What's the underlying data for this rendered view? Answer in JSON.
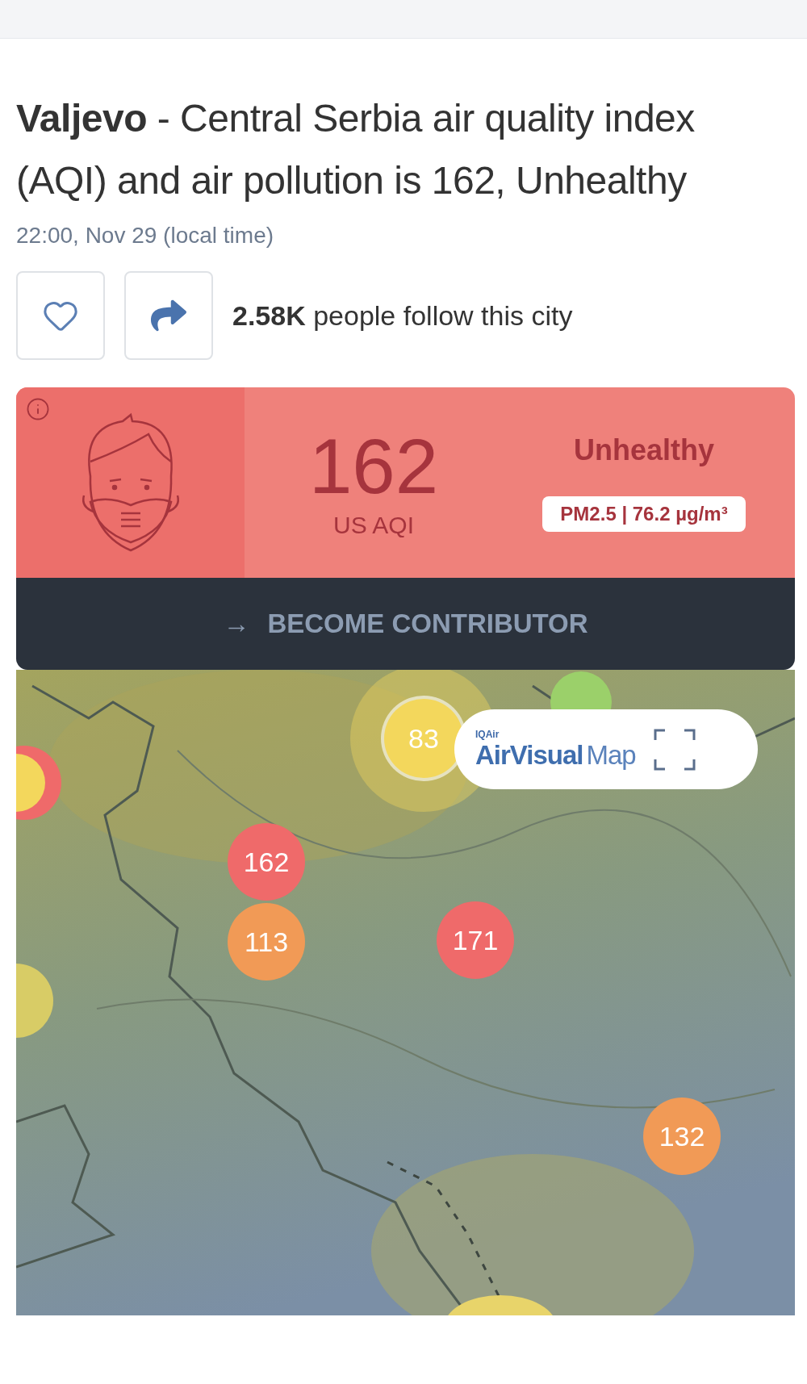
{
  "headline": "**Valjevo** - Central Serbia air quality index (AQI) and air pollution is 162, Unhealthy",
  "timestamp": "22:00, Nov 29 (local time)",
  "follow": {
    "liked": false,
    "text": "**2.58K** people follow this city"
  },
  "aqi": {
    "value": "162",
    "unit": "US AQI",
    "status": "Unhealthy",
    "pollutant": "PM2.5 | 76.2 µg/m³"
  },
  "contributor": {
    "arrow": "→",
    "label": "BECOME CONTRIBUTOR"
  },
  "map": {
    "kind": "picture",
    "badge": {
      "brand": "IQAir",
      "title": "AirVisual",
      "suffix": "Map"
    },
    "markers": [
      {
        "value": "83",
        "color": "#f3d75c",
        "halo": true
      },
      {
        "value": "162",
        "color": "#ef6a6a",
        "halo": false
      },
      {
        "value": "113",
        "color": "#f19a56",
        "halo": false
      },
      {
        "value": "171",
        "color": "#ef6a6a",
        "halo": false
      },
      {
        "value": "132",
        "color": "#f19a56",
        "halo": false
      }
    ]
  }
}
